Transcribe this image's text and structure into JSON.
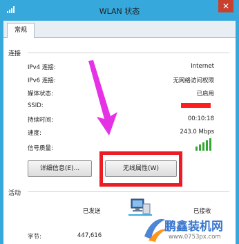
{
  "window": {
    "title": "WLAN 状态",
    "close_label": "✕",
    "accent_color": "#36a8dc"
  },
  "tabs": [
    {
      "label": "常规"
    }
  ],
  "connection": {
    "section_title": "连接",
    "rows": [
      {
        "label": "IPv4 连接:",
        "value": "Internet"
      },
      {
        "label": "IPv6 连接:",
        "value": "无网络访问权限"
      },
      {
        "label": "媒体状态:",
        "value": "已启用"
      },
      {
        "label": "SSID:",
        "value": ""
      },
      {
        "label": "持续时间:",
        "value": "00:10:18"
      },
      {
        "label": "速度:",
        "value": "243.0 Mbps"
      }
    ],
    "signal_label": "信号质量:",
    "signal_bars": 5,
    "signal_color": "#34a834"
  },
  "buttons": {
    "details": "详细信息(E)...",
    "wireless_properties": "无线属性(W)"
  },
  "activity": {
    "section_title": "活动",
    "sent_label": "已发送",
    "received_label": "已接收",
    "bytes_label": "字节:",
    "bytes_sent": "447,616"
  },
  "annotation": {
    "highlight_color": "#ec1c24",
    "arrow_color": "#e532e5"
  },
  "watermark": {
    "site_name": "鹏鑫装机网",
    "url": "www.0753px.com"
  }
}
